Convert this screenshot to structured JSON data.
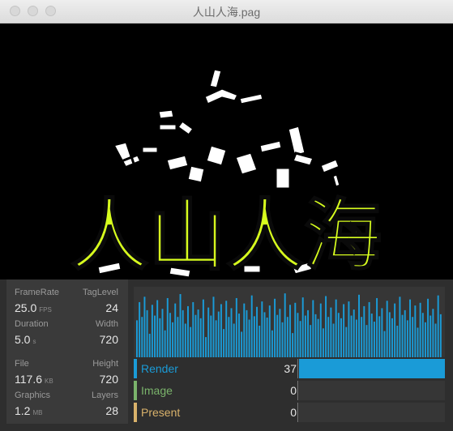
{
  "window": {
    "title": "人山人海.pag"
  },
  "canvas": {
    "headline": "人山人海",
    "headline_color": "#d8ff1e",
    "background": "#000000"
  },
  "stats": {
    "metrics": [
      {
        "label": "FrameRate",
        "value": "25.0",
        "unit": "FPS"
      },
      {
        "label": "TagLevel",
        "value": "24"
      },
      {
        "label": "Duration",
        "value": "5.0",
        "unit": "s"
      },
      {
        "label": "Width",
        "value": "720"
      },
      {
        "label": "File",
        "value": "117.6",
        "unit": "KB"
      },
      {
        "label": "Height",
        "value": "720"
      },
      {
        "label": "Graphics",
        "value": "1.2",
        "unit": "MB"
      },
      {
        "label": "Layers",
        "value": "28"
      }
    ],
    "timing": [
      {
        "label": "Render",
        "value": "37",
        "color": "#1a9bd7",
        "fraction": 1.0
      },
      {
        "label": "Image",
        "value": "0",
        "color": "#7ab36b",
        "fraction": 0.0
      },
      {
        "label": "Present",
        "value": "0",
        "color": "#d9b26b",
        "fraction": 0.0
      }
    ],
    "frame_bars": [
      0.55,
      0.82,
      0.6,
      0.9,
      0.7,
      0.35,
      0.78,
      0.62,
      0.85,
      0.58,
      0.72,
      0.4,
      0.88,
      0.66,
      0.52,
      0.8,
      0.6,
      0.94,
      0.7,
      0.5,
      0.76,
      0.45,
      0.82,
      0.63,
      0.71,
      0.58,
      0.86,
      0.3,
      0.74,
      0.62,
      0.9,
      0.55,
      0.68,
      0.79,
      0.42,
      0.84,
      0.6,
      0.73,
      0.5,
      0.88,
      0.65,
      0.38,
      0.8,
      0.7,
      0.56,
      0.92,
      0.61,
      0.75,
      0.47,
      0.83,
      0.67,
      0.59,
      0.77,
      0.4,
      0.87,
      0.63,
      0.72,
      0.52,
      0.95,
      0.6,
      0.78,
      0.36,
      0.81,
      0.66,
      0.54,
      0.89,
      0.62,
      0.7,
      0.48,
      0.85,
      0.64,
      0.57,
      0.8,
      0.43,
      0.91,
      0.6,
      0.74,
      0.5,
      0.86,
      0.66,
      0.58,
      0.79,
      0.45,
      0.83,
      0.62,
      0.71,
      0.56,
      0.93,
      0.6,
      0.76,
      0.48,
      0.82,
      0.65,
      0.53,
      0.88,
      0.61,
      0.73,
      0.39,
      0.84,
      0.67,
      0.58,
      0.8,
      0.47,
      0.9,
      0.63,
      0.7,
      0.55,
      0.86,
      0.6,
      0.77,
      0.44,
      0.81,
      0.66,
      0.52,
      0.87,
      0.62,
      0.72,
      0.5,
      0.92,
      0.64
    ]
  }
}
